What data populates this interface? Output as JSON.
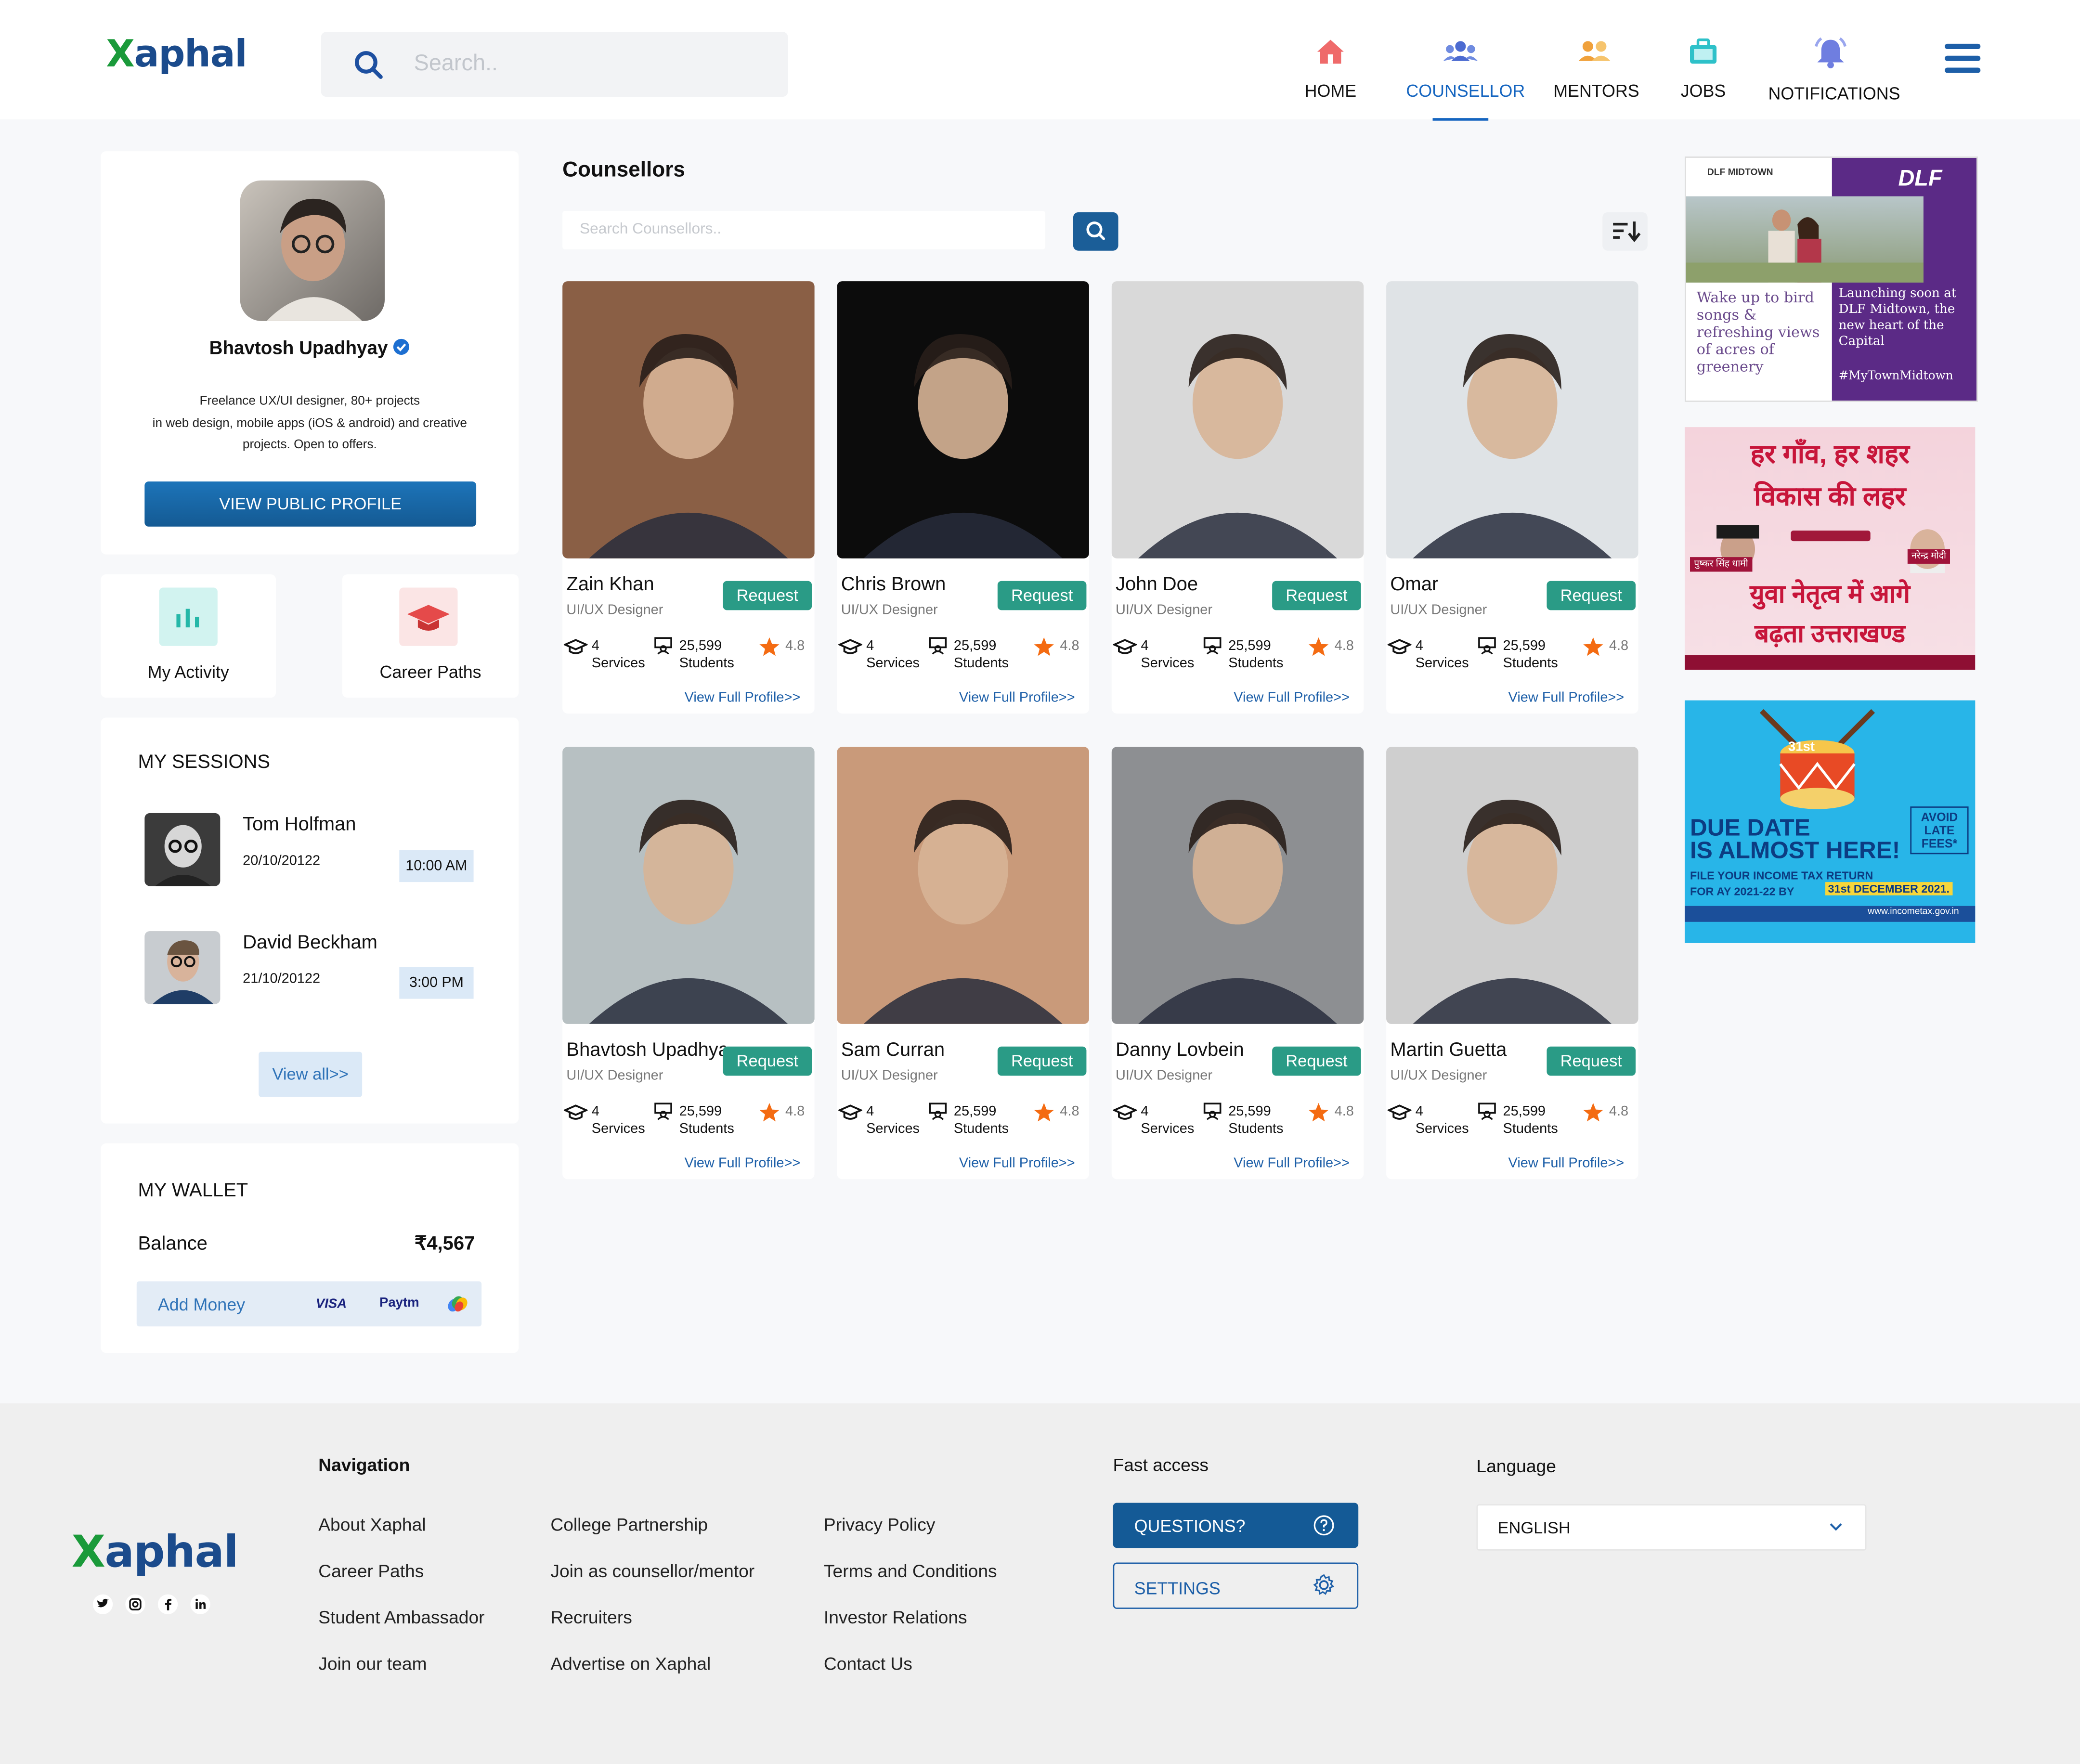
{
  "header": {
    "logo_text": "aphal",
    "logo_x": "X",
    "search_placeholder": "Search..",
    "nav": [
      {
        "label": "HOME",
        "icon": "home-icon",
        "active": false
      },
      {
        "label": "COUNSELLOR",
        "icon": "counsellor-icon",
        "active": true
      },
      {
        "label": "MENTORS",
        "icon": "mentors-icon",
        "active": false
      },
      {
        "label": "JOBS",
        "icon": "jobs-icon",
        "active": false
      },
      {
        "label": "NOTIFICATIONS",
        "icon": "bell-icon",
        "active": false
      }
    ]
  },
  "profile": {
    "name": "Bhavtosh Upadhyay",
    "bio_lines": [
      "Freelance UX/UI designer, 80+ projects",
      "in web design, mobile apps (iOS & android) and creative",
      "projects. Open to offers."
    ],
    "button_label": "VIEW PUBLIC PROFILE"
  },
  "quick_links": [
    {
      "label": "My Activity",
      "icon": "activity-chart-icon"
    },
    {
      "label": "Career Paths",
      "icon": "graduation-cap-icon"
    }
  ],
  "sessions": {
    "title": "MY SESSIONS",
    "items": [
      {
        "name": "Tom Holfman",
        "date": "20/10/20122",
        "time": "10:00 AM"
      },
      {
        "name": "David Beckham",
        "date": "21/10/20122",
        "time": "3:00 PM"
      }
    ],
    "view_all": "View all>>"
  },
  "wallet": {
    "title": "MY WALLET",
    "balance_label": "Balance",
    "balance_value": "₹4,567",
    "add_money": "Add Money",
    "payment_logos": [
      "VISA",
      "Paytm",
      "gpay-icon"
    ]
  },
  "counsellors_section": {
    "title": "Counsellors",
    "search_placeholder": "Search Counsellors..",
    "cards": [
      {
        "name": "Zain Khan",
        "role": "UI/UX Designer",
        "services": "4",
        "services_label": "Services",
        "students": "25,599",
        "students_label": "Students",
        "rating": "4.8",
        "request": "Request",
        "profile_link": "View Full Profile>>",
        "photo_bg": "#8a5f45"
      },
      {
        "name": "Chris Brown",
        "role": "UI/UX Designer",
        "services": "4",
        "services_label": "Services",
        "students": "25,599",
        "students_label": "Students",
        "rating": "4.8",
        "request": "Request",
        "profile_link": "View Full Profile>>",
        "photo_bg": "#0c0c0c"
      },
      {
        "name": "John Doe",
        "role": "UI/UX Designer",
        "services": "4",
        "services_label": "Services",
        "students": "25,599",
        "students_label": "Students",
        "rating": "4.8",
        "request": "Request",
        "profile_link": "View Full Profile>>",
        "photo_bg": "#d9d9d9"
      },
      {
        "name": "Omar",
        "role": "UI/UX Designer",
        "services": "4",
        "services_label": "Services",
        "students": "25,599",
        "students_label": "Students",
        "rating": "4.8",
        "request": "Request",
        "profile_link": "View Full Profile>>",
        "photo_bg": "#dfe3e6"
      },
      {
        "name": "Bhavtosh Upadhyay",
        "role": "UI/UX Designer",
        "services": "4",
        "services_label": "Services",
        "students": "25,599",
        "students_label": "Students",
        "rating": "4.8",
        "request": "Request",
        "profile_link": "View Full Profile>>",
        "photo_bg": "#b7c0c2"
      },
      {
        "name": "Sam Curran",
        "role": "UI/UX Designer",
        "services": "4",
        "services_label": "Services",
        "students": "25,599",
        "students_label": "Students",
        "rating": "4.8",
        "request": "Request",
        "profile_link": "View Full Profile>>",
        "photo_bg": "#c99a7a"
      },
      {
        "name": "Danny Lovbein",
        "role": "UI/UX Designer",
        "services": "4",
        "services_label": "Services",
        "students": "25,599",
        "students_label": "Students",
        "rating": "4.8",
        "request": "Request",
        "profile_link": "View Full Profile>>",
        "photo_bg": "#8d8f92"
      },
      {
        "name": "Martin Guetta",
        "role": "UI/UX Designer",
        "services": "4",
        "services_label": "Services",
        "students": "25,599",
        "students_label": "Students",
        "rating": "4.8",
        "request": "Request",
        "profile_link": "View Full Profile>>",
        "photo_bg": "#cfcfcf"
      }
    ]
  },
  "ads": [
    {
      "brand": "DLF",
      "brand_sub": "DLF MIDTOWN",
      "left_text": "Wake up to bird songs & refreshing views of acres of greenery",
      "right_text": "Launching soon at DLF Midtown, the new heart of the Capital",
      "tag": "#MyTownMidtown"
    },
    {
      "line1": "हर गाँव, हर शहर",
      "line2": "विकास की लहर",
      "line3": "युवा नेतृत्व में आगे",
      "line4": "बढ़ता उत्तराखण्ड",
      "left_name": "पुष्कर सिंह धामी",
      "right_name": "नरेन्द्र मोदी"
    },
    {
      "badge": "31st",
      "line1": "DUE DATE",
      "line2": "IS ALMOST HERE!",
      "line3": "FILE YOUR INCOME TAX RETURN",
      "line4": "FOR AY 2021-22 BY",
      "deadline": "31st DECEMBER 2021.",
      "side": "AVOID LATE FEES*",
      "site": "www.incometax.gov.in"
    }
  ],
  "footer": {
    "logo_text": "aphal",
    "logo_x": "X",
    "social": [
      "twitter-icon",
      "instagram-icon",
      "facebook-icon",
      "linkedin-icon"
    ],
    "nav_title": "Navigation",
    "col1": [
      "About Xaphal",
      "Career Paths",
      "Student Ambassador",
      "Join our team"
    ],
    "col2": [
      "College Partnership",
      "Join as counsellor/mentor",
      "Recruiters",
      "Advertise on Xaphal"
    ],
    "col3": [
      "Privacy Policy",
      "Terms and Conditions",
      "Investor Relations",
      "Contact Us"
    ],
    "fast_title": "Fast access",
    "questions": "QUESTIONS?",
    "settings": "SETTINGS",
    "language_title": "Language",
    "language_value": "ENGLISH"
  }
}
